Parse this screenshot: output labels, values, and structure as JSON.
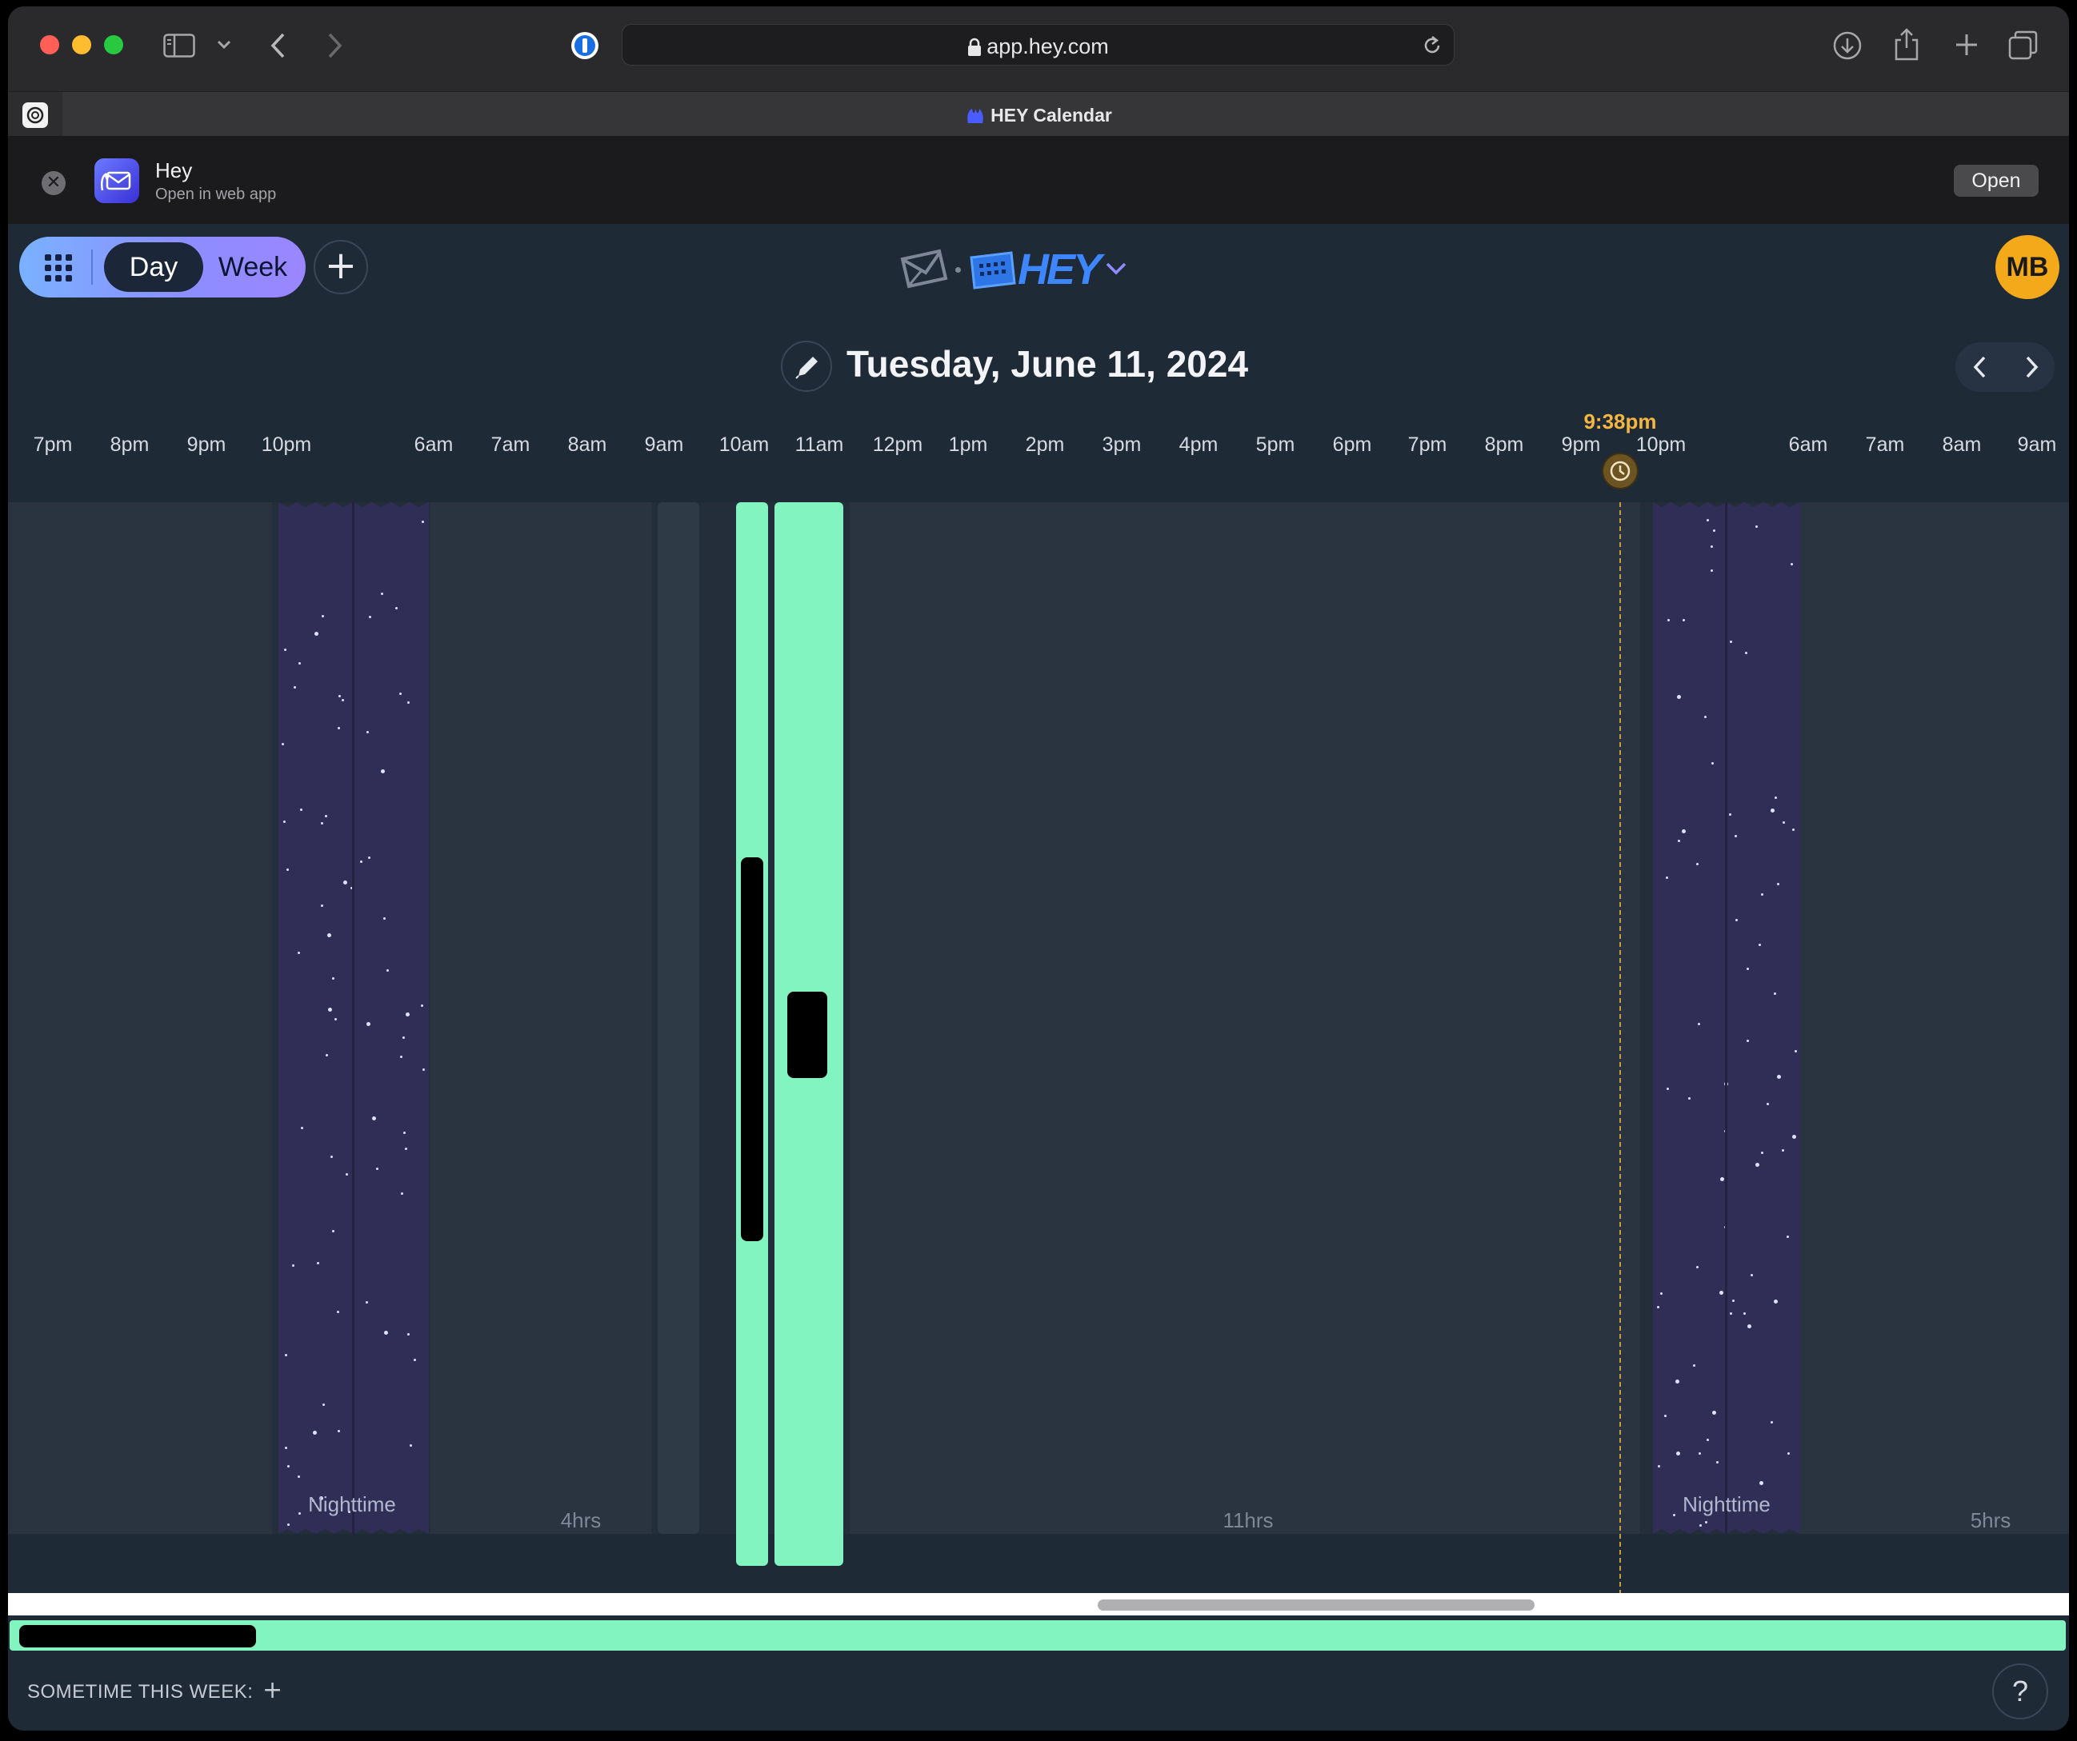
{
  "browser": {
    "url": "app.hey.com",
    "tab_title": "HEY Calendar"
  },
  "app_banner": {
    "app_name": "Hey",
    "subtitle": "Open in web app",
    "open_label": "Open"
  },
  "header": {
    "view_day": "Day",
    "view_week": "Week",
    "logo_text": "HEY",
    "avatar_initials": "MB",
    "date_title": "Tuesday, June 11, 2024"
  },
  "timeline": {
    "hours": [
      "7pm",
      "8pm",
      "9pm",
      "10pm",
      "6am",
      "7am",
      "8am",
      "9am",
      "10am",
      "11am",
      "12pm",
      "1pm",
      "2pm",
      "3pm",
      "4pm",
      "5pm",
      "6pm",
      "7pm",
      "8pm",
      "9pm",
      "10pm",
      "6am",
      "7am",
      "8am",
      "9am"
    ],
    "now_time": "9:38pm",
    "night_label": "Nighttime",
    "gap_labels": [
      "4hrs",
      "11hrs",
      "5hrs"
    ]
  },
  "footer": {
    "sometime_label": "SOMETIME THIS WEEK:",
    "sometime_add": "+",
    "help": "?"
  },
  "colors": {
    "event_green": "#82f4c0",
    "night_purple": "#302e57",
    "now_orange": "#f4b541",
    "avatar_orange": "#f4a91b"
  }
}
